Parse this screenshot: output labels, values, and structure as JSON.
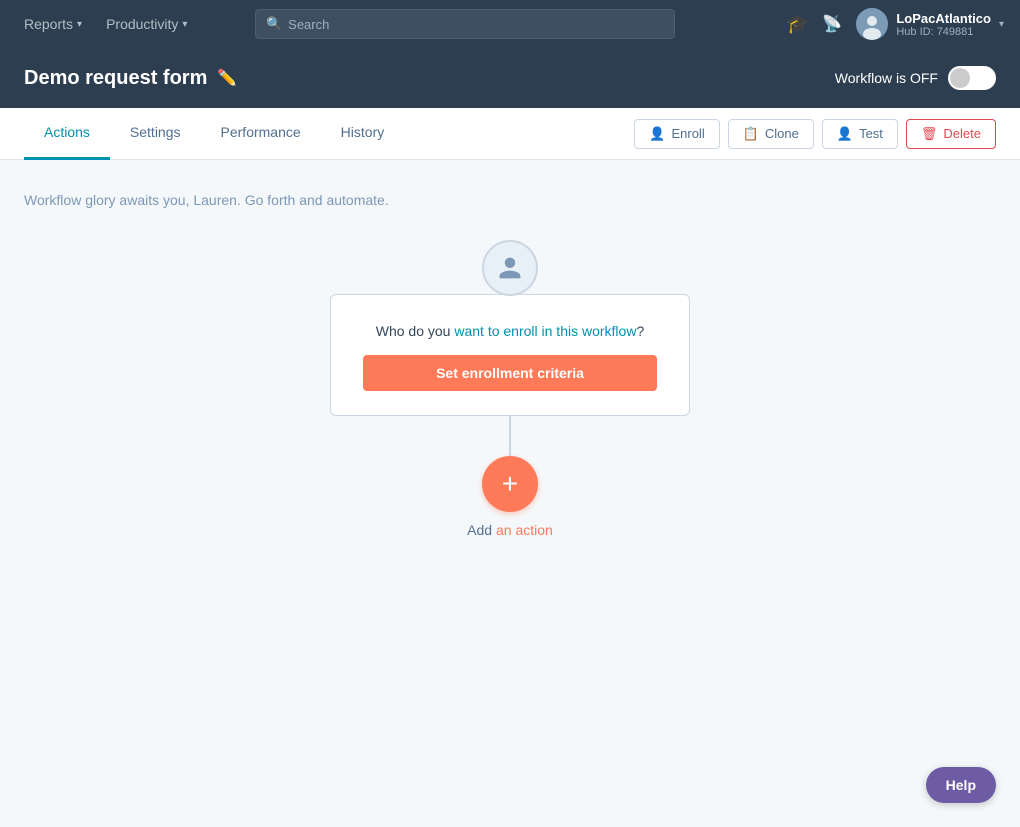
{
  "nav": {
    "reports_label": "Reports",
    "productivity_label": "Productivity",
    "search_placeholder": "Search"
  },
  "user": {
    "name": "LoPacAtlantico",
    "hub_id": "Hub ID: 749881"
  },
  "subheader": {
    "title": "Demo request form",
    "workflow_off": "Workflow is OFF"
  },
  "tabs": {
    "actions": "Actions",
    "settings": "Settings",
    "performance": "Performance",
    "history": "History",
    "enroll": "Enroll",
    "clone": "Clone",
    "test": "Test",
    "delete": "Delete"
  },
  "main": {
    "tagline": "Workflow glory awaits you, Lauren. Go forth and automate.",
    "enrollment_question": "Who do you want to enroll in this workflow?",
    "set_criteria_btn": "Set enrollment criteria",
    "add_action_label": "Add an action"
  },
  "help": {
    "label": "Help"
  }
}
